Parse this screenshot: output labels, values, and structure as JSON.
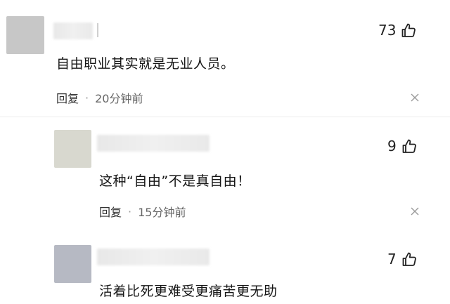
{
  "comments": [
    {
      "avatar_color": "#c7c7c7",
      "likes": "73",
      "text": "自由职业其实就是无业人员。",
      "reply_label": "回复",
      "separator": "·",
      "time": "20分钟前"
    },
    {
      "avatar_color": "#d8d8cf",
      "likes": "9",
      "text": "这种“自由”不是真自由！",
      "reply_label": "回复",
      "separator": "·",
      "time": "15分钟前"
    },
    {
      "avatar_color": "#b6b9c3",
      "likes": "7",
      "text": "活着比死更难受更痛苦更无助"
    }
  ],
  "icons": {
    "like": "thumbs-up-icon",
    "close": "close-icon"
  }
}
